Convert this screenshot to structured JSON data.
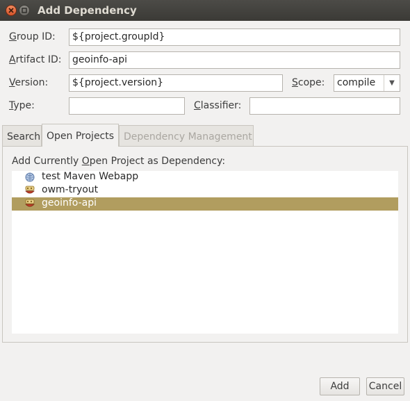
{
  "window": {
    "title": "Add Dependency"
  },
  "form": {
    "group_id": {
      "label_pre": "",
      "label_u": "G",
      "label_post": "roup ID:",
      "value": "${project.groupId}"
    },
    "artifact_id": {
      "label_pre": "",
      "label_u": "A",
      "label_post": "rtifact ID:",
      "value": "geoinfo-api"
    },
    "version": {
      "label_pre": "",
      "label_u": "V",
      "label_post": "ersion:",
      "value": "${project.version}"
    },
    "scope": {
      "label_pre": "",
      "label_u": "S",
      "label_post": "cope:",
      "value": "compile"
    },
    "type": {
      "label_pre": "",
      "label_u": "T",
      "label_post": "ype:",
      "value": ""
    },
    "classifier": {
      "label_pre": "",
      "label_u": "C",
      "label_post": "lassifier:",
      "value": ""
    }
  },
  "tabs": [
    {
      "label": "Search",
      "state": "normal"
    },
    {
      "label": "Open Projects",
      "state": "active"
    },
    {
      "label": "Dependency Management",
      "state": "disabled"
    }
  ],
  "open_projects": {
    "heading_pre": "Add Currently ",
    "heading_u": "O",
    "heading_post": "pen Project as Dependency:",
    "items": [
      {
        "label": "test Maven Webapp",
        "icon": "web-project-icon",
        "selected": false
      },
      {
        "label": "owm-tryout",
        "icon": "maven-project-icon",
        "selected": false
      },
      {
        "label": "geoinfo-api",
        "icon": "maven-project-icon",
        "selected": true
      }
    ]
  },
  "buttons": {
    "add": "Add",
    "cancel": "Cancel"
  },
  "colors": {
    "selection": "#b19d5f",
    "titlebar": "#3b3a36",
    "close_button": "#e2622f"
  }
}
